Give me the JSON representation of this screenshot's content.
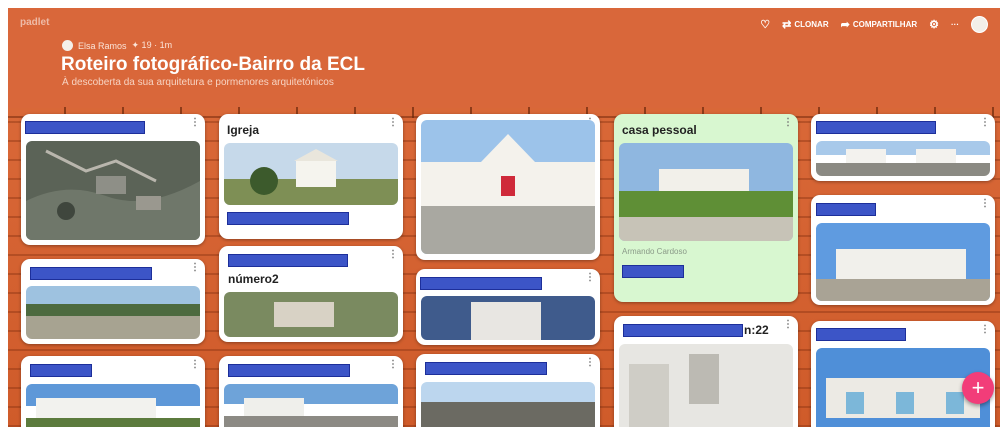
{
  "brand": "padlet",
  "header": {
    "author": "Elsa Ramos",
    "meta": "✦ 19 · 1m",
    "title": "Roteiro fotográfico-Bairro da ECL",
    "subtitle": "À descoberta da sua arquitetura e pormenores arquitetónicos"
  },
  "toolbar": {
    "heart_icon": "heart-icon",
    "clone_label": "CLONAR",
    "share_label": "COMPARTILHAR",
    "settings_icon": "gear-icon",
    "more_label": "···"
  },
  "cards": {
    "igreja_title": "Igreja",
    "numero_title": "número2",
    "casa_title": "casa pessoal",
    "casa_author": "Armando Cardoso",
    "n22_title": "n:22",
    "dots": "⋮"
  },
  "fab_label": "+",
  "colors": {
    "board": "#d55f2f",
    "card": "#ffffff",
    "highlight_card": "#d8f7d0",
    "fab": "#f23d79",
    "redaction": "#3c55c7"
  }
}
